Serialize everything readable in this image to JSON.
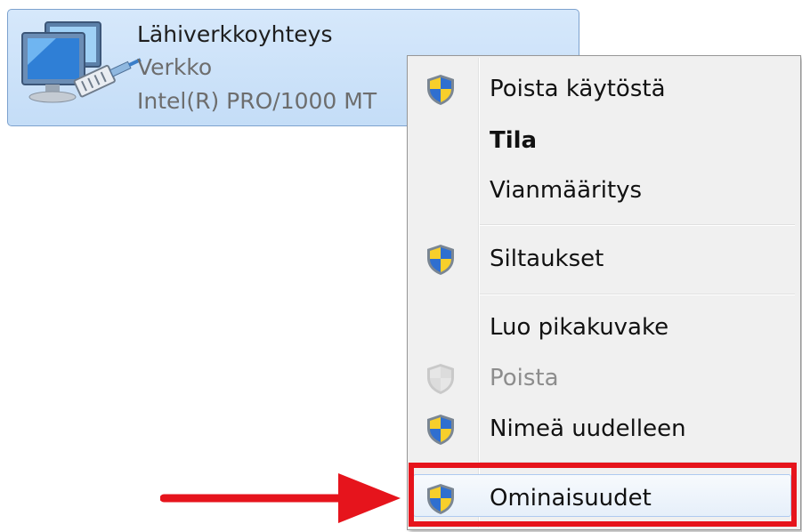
{
  "adapter": {
    "name": "Lähiverkkoyhteys",
    "network": "Verkko",
    "device": "Intel(R) PRO/1000 MT"
  },
  "menu": {
    "items": [
      {
        "label": "Poista käytöstä",
        "icon": "uac-shield-icon",
        "style": "normal"
      },
      {
        "label": "Tila",
        "icon": "",
        "style": "bold"
      },
      {
        "label": "Vianmääritys",
        "icon": "",
        "style": "normal"
      },
      {
        "label": "Siltaukset",
        "icon": "uac-shield-icon",
        "style": "normal"
      },
      {
        "label": "Luo pikakuvake",
        "icon": "",
        "style": "normal"
      },
      {
        "label": "Poista",
        "icon": "uac-shield-icon",
        "style": "disabled"
      },
      {
        "label": "Nimeä uudelleen",
        "icon": "uac-shield-icon",
        "style": "normal"
      },
      {
        "label": "Ominaisuudet",
        "icon": "uac-shield-icon",
        "style": "highlighted"
      }
    ]
  },
  "colors": {
    "annotation": "#e6141c",
    "selection": "#c4ddf7",
    "menu_background": "#f0f0f0"
  }
}
